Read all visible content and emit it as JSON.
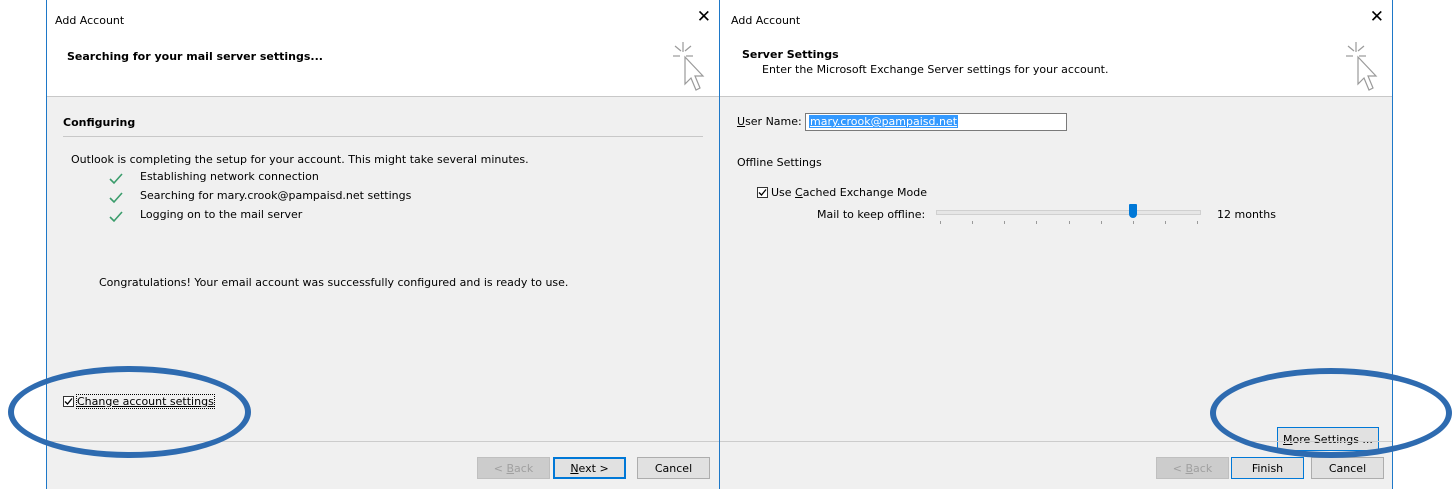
{
  "left_dialog": {
    "title": "Add Account",
    "header": "Searching for your mail server settings...",
    "section_heading": "Configuring",
    "intro": "Outlook is completing the setup for your account. This might take several minutes.",
    "steps": [
      "Establishing network connection",
      "Searching for mary.crook@pampaisd.net settings",
      "Logging on to the mail server"
    ],
    "congrats": "Congratulations! Your email account was successfully configured and is ready to use.",
    "change_settings_label": "Change account settings",
    "change_settings_checked": true,
    "buttons": {
      "back_prefix": "< ",
      "back_key": "B",
      "back_rest": "ack",
      "next_key": "N",
      "next_rest": "ext >",
      "cancel": "Cancel"
    }
  },
  "right_dialog": {
    "title": "Add Account",
    "header": "Server Settings",
    "subheader": "Enter the Microsoft Exchange Server settings for your account.",
    "user_name_key": "U",
    "user_name_rest": "ser Name:",
    "user_name_value": "mary.crook@pampaisd.net",
    "offline_heading": "Offline Settings",
    "cached_mode_prefix": "Use ",
    "cached_mode_key": "C",
    "cached_mode_rest": "ached Exchange Mode",
    "cached_mode_checked": true,
    "mail_offline_label": "Mail to keep offline:",
    "mail_offline_value": "12 months",
    "slider_fraction": 0.75,
    "more_settings_key": "M",
    "more_settings_rest": "ore Settings ...",
    "buttons": {
      "back_prefix": "< ",
      "back_key": "B",
      "back_rest": "ack",
      "finish": "Finish",
      "cancel": "Cancel"
    }
  },
  "colors": {
    "accent": "#0078d7",
    "check": "#3a9c6b",
    "annotation": "#2e6bb0"
  }
}
